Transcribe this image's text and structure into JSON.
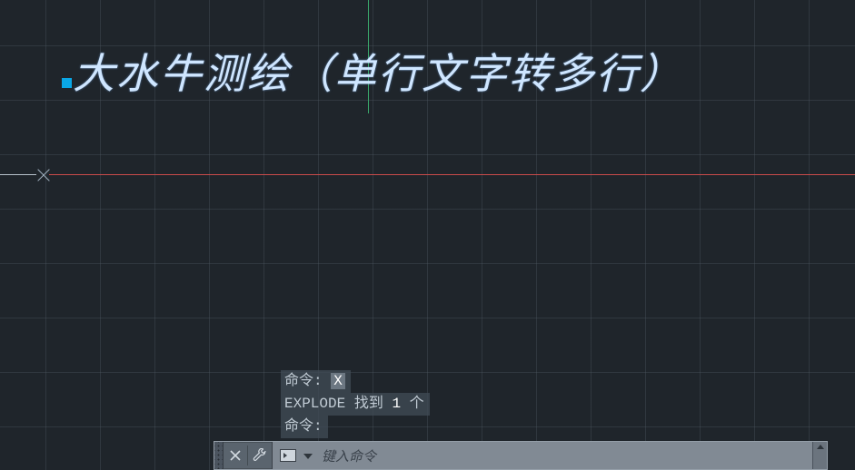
{
  "drawing": {
    "selected_text": "大水牛测绘（单行文字转多行）"
  },
  "command_history": {
    "line1_prefix": "命令: ",
    "line1_cmd": "X",
    "line2_cmd": "EXPLODE",
    "line2_mid": " 找到 ",
    "line2_count": "1",
    "line2_suffix": " 个",
    "line3": "命令:"
  },
  "command_line": {
    "placeholder": "键入命令"
  }
}
